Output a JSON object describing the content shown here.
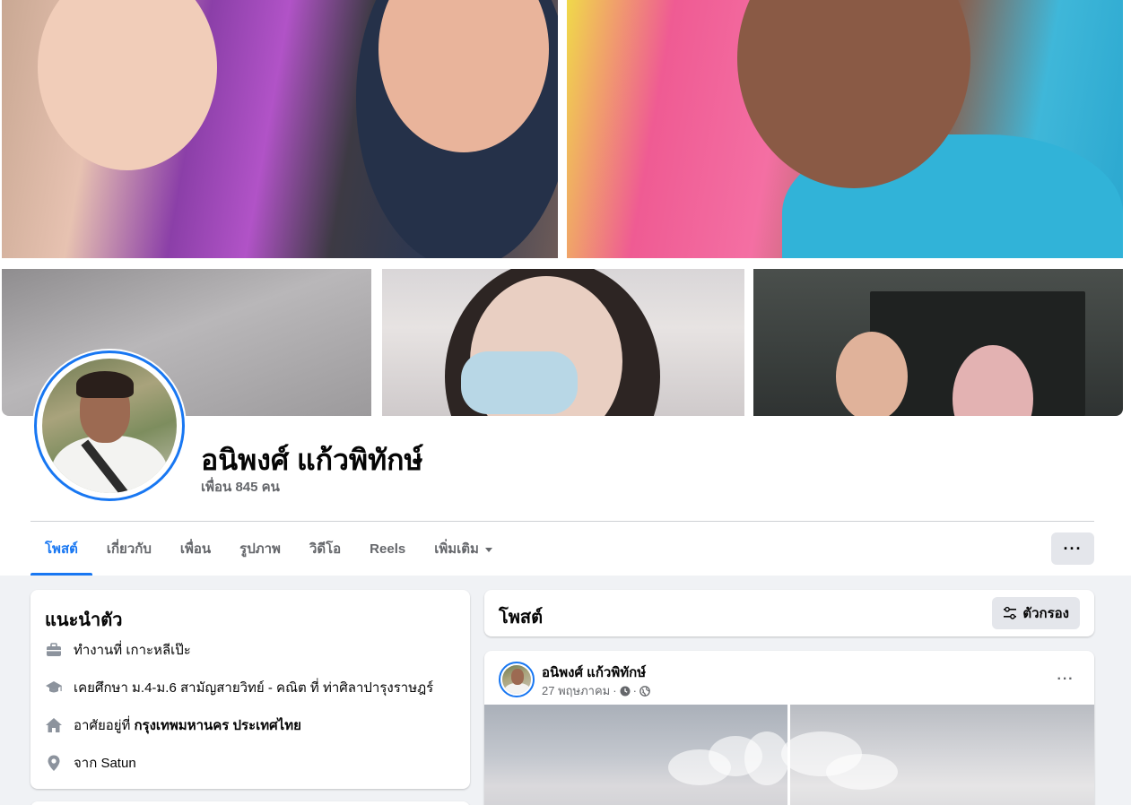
{
  "profile": {
    "name": "อนิพงศ์ แก้วพิทักษ์",
    "friends": "เพื่อน 845 คน"
  },
  "tabs": [
    {
      "label": "โพสต์",
      "active": true
    },
    {
      "label": "เกี่ยวกับ",
      "active": false
    },
    {
      "label": "เพื่อน",
      "active": false
    },
    {
      "label": "รูปภาพ",
      "active": false
    },
    {
      "label": "วิดีโอ",
      "active": false
    },
    {
      "label": "Reels",
      "active": false
    },
    {
      "label": "เพิ่มเติม",
      "active": false
    }
  ],
  "more_button_label": "···",
  "intro": {
    "title": "แนะนำตัว",
    "work": {
      "icon": "briefcase-icon",
      "text": "ทำงานที่ เกาะหลีเป๊ะ"
    },
    "education": {
      "icon": "graduation-cap-icon",
      "text": "เคยศึกษา ม.4-ม.6 สามัญสายวิทย์ - คณิต ที่ ท่าศิลาปารุงราษฎร์"
    },
    "lives": {
      "icon": "home-icon",
      "prefix": "อาศัยอยู่ที่",
      "value": "กรุงเทพมหานคร ประเทศไทย"
    },
    "from": {
      "icon": "location-pin-icon",
      "text": "จาก Satun"
    }
  },
  "posts": {
    "title": "โพสต์",
    "filter_label": "ตัวกรอง"
  },
  "post": {
    "author": "อนิพงศ์ แก้วพิทักษ์",
    "date": "27 พฤษภาคม",
    "more_label": "···"
  },
  "colors": {
    "accent": "#1877f2",
    "background": "#f0f2f5",
    "secondary_text": "#65676b",
    "button_bg": "#e4e6eb"
  }
}
